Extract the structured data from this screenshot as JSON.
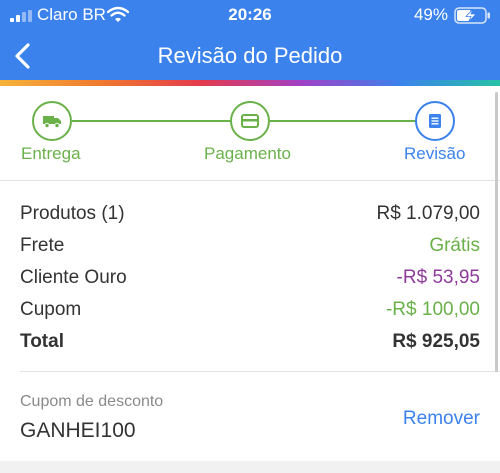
{
  "status_bar": {
    "carrier": "Claro BR",
    "time": "20:26",
    "battery": "49%"
  },
  "nav": {
    "title": "Revisão do Pedido",
    "back_icon": "chevron-left-icon"
  },
  "stepper": {
    "steps": [
      {
        "label": "Entrega",
        "icon": "truck-icon",
        "color": "#6ab14a"
      },
      {
        "label": "Pagamento",
        "icon": "credit-card-icon",
        "color": "#6ab14a"
      },
      {
        "label": "Revisão",
        "icon": "list-icon",
        "color": "#3b82ec"
      }
    ]
  },
  "summary": {
    "rows": [
      {
        "label": "Produtos (1)",
        "value": "R$ 1.079,00",
        "color": "#333333"
      },
      {
        "label": "Frete",
        "value": "Grátis",
        "color": "#6ab14a"
      },
      {
        "label": "Cliente Ouro",
        "value": "-R$ 53,95",
        "color": "#8e3b9b"
      },
      {
        "label": "Cupom",
        "value": "-R$ 100,00",
        "color": "#6ab14a"
      }
    ],
    "total": {
      "label": "Total",
      "value": "R$ 925,05"
    }
  },
  "coupon": {
    "caption": "Cupom de desconto",
    "code": "GANHEI100",
    "remove_label": "Remover"
  },
  "colors": {
    "header": "#3b82ec",
    "green": "#6ab14a",
    "purple": "#8e3b9b",
    "blue": "#3b82ec"
  }
}
